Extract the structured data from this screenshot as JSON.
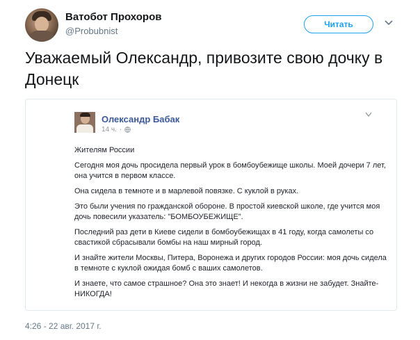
{
  "tweet": {
    "author_name": "Ватобот Прохоров",
    "author_handle": "@Probubnist",
    "follow_label": "Читать",
    "text": "Уважаемый Олександр, привозите свою дочку в Донецк",
    "timestamp": "4:26 - 22 авг. 2017 г."
  },
  "embedded_post": {
    "author_name": "Олександр Бабак",
    "time": "14 ч.",
    "separator": "·",
    "paragraphs": [
      "Жителям России",
      "Сегодня моя дочь просидела первый урок в бомбоубежище школы. Моей дочери 7 лет, она учится в первом классе.",
      "Она сидела в темноте и в марлевой повязке. С куклой в руках.",
      "Это были учения по гражданской обороне. В простой киевской школе, где учится моя дочь повесили указатель: \"БОМБОУБЕЖИЩЕ\".",
      "Последний раз дети в Киеве сидели в бомбоубежищах в 41 году, когда самолеты со свастикой сбрасывали бомбы на наш мирный город.",
      "И знайте жители Москвы, Питера, Воронежа и других городов России: моя дочь сидела в темноте с куклой ожидая бомб с ваших самолетов.",
      "И знаете, что самое страшное? Она это знает! И некогда в жизни не забудет. Знайте- НИКОГДА!"
    ]
  },
  "colors": {
    "twitter_blue": "#1da1f2",
    "facebook_blue": "#3b5998",
    "muted_text": "#657786"
  }
}
